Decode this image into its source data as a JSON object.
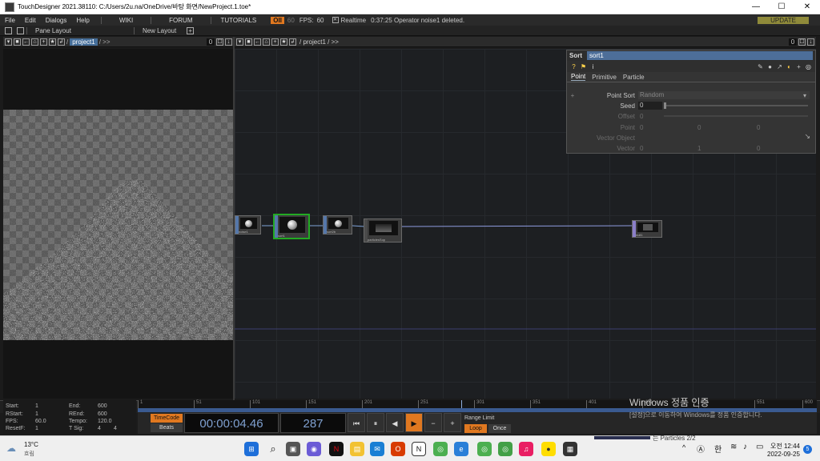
{
  "window": {
    "title": "TouchDesigner 2021.38110: C:/Users/2u.na/OneDrive/바탕 화면/NewProject.1.toe*",
    "minimize": "—",
    "maximize": "☐",
    "close": "✕"
  },
  "menu": {
    "items": [
      "File",
      "Edit",
      "Dialogs",
      "Help"
    ],
    "links": [
      "WIKI",
      "FORUM",
      "TUTORIALS"
    ],
    "oii": "OII",
    "fps_cap": "60",
    "fps_label": "FPS:",
    "fps_value": "60",
    "realtime_label": "Realtime",
    "status": "0:37:25 Operator noise1 deleted.",
    "update": "UPDATE"
  },
  "panebar": {
    "pane_layout": "Pane Layout",
    "new_layout": "New Layout",
    "add": "+"
  },
  "left_pane": {
    "path": "project1",
    "sep": "/ >>",
    "count": "0"
  },
  "right_pane": {
    "path": "/ project1 / >>",
    "count": "0"
  },
  "nodes": [
    {
      "label": "noise1"
    },
    {
      "label": "sort1"
    },
    {
      "label": "sort2b"
    },
    {
      "label": "particlesSop"
    },
    {
      "label": "null1"
    }
  ],
  "params": {
    "type": "Sort",
    "name": "sort1",
    "tabs": [
      "Point",
      "Primitive",
      "Particle"
    ],
    "rows": [
      {
        "label": "Point Sort",
        "value": "Random"
      },
      {
        "label": "Seed",
        "value": "0"
      },
      {
        "label": "Offset",
        "value": "0"
      },
      {
        "label": "Point",
        "v1": "0",
        "v2": "0",
        "v3": "0"
      },
      {
        "label": "Vector Object",
        "value": ""
      },
      {
        "label": "Vector",
        "v1": "0",
        "v2": "1",
        "v3": "0"
      }
    ]
  },
  "timeline": {
    "ticks": [
      "1",
      "51",
      "101",
      "151",
      "201",
      "251",
      "301",
      "351",
      "401",
      "451",
      "501",
      "551",
      "600"
    ],
    "info": {
      "start_label": "Start:",
      "start": "1",
      "end_label": "End:",
      "end": "600",
      "rstart_label": "RStart:",
      "rstart": "1",
      "rend_label": "REnd:",
      "rend": "600",
      "fps_label": "FPS:",
      "fps": "60.0",
      "tempo_label": "Tempo:",
      "tempo": "120.0",
      "resetf_label": "ResetF:",
      "resetf": "1",
      "tsig_label": "T Sig:",
      "tsig1": "4",
      "tsig2": "4"
    },
    "timecode": "TimeCode",
    "beats": "Beats",
    "time": "00:00:04.46",
    "frame": "287",
    "range_limit": "Range Limit",
    "loop": "Loop",
    "once": "Once",
    "transport": [
      "⏮",
      "⏸",
      "◀",
      "▶",
      "−",
      "+"
    ]
  },
  "watermark": {
    "title": "Windows 정품 인증",
    "sub": "[설정]으로 이동하여 Windows를 정품 인증합니다."
  },
  "taskbar": {
    "weather_temp": "13°C",
    "weather_desc": "흐림",
    "preview_text": "는 Particles 2/2",
    "ime": "한",
    "time": "오전 12:44",
    "date": "2022-09-25",
    "badge": "5"
  },
  "colors": {
    "accent": "#4d6e99",
    "orange": "#e07820",
    "selected_node": "#22aa22"
  }
}
